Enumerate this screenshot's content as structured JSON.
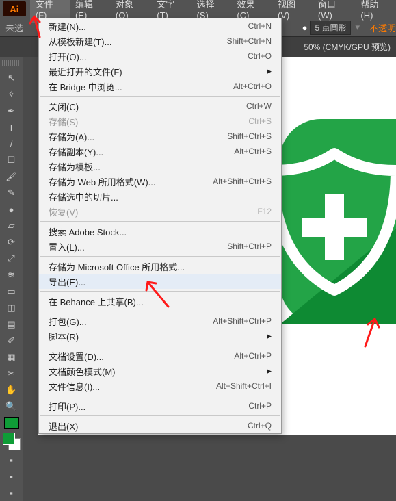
{
  "app": {
    "icon_text": "Ai"
  },
  "menubar": {
    "items": [
      {
        "label": "文件(F)",
        "active": true
      },
      {
        "label": "编辑(E)"
      },
      {
        "label": "对象(O)"
      },
      {
        "label": "文字(T)"
      },
      {
        "label": "选择(S)"
      },
      {
        "label": "效果(C)"
      },
      {
        "label": "视图(V)"
      },
      {
        "label": "窗口(W)"
      },
      {
        "label": "帮助(H)"
      }
    ]
  },
  "optionsbar": {
    "left_label": "未选",
    "round_label": "5 点圆形",
    "opacity_label": "不透明"
  },
  "tabbar": {
    "doc_status": "50% (CMYK/GPU 预览)"
  },
  "tools": {
    "names": [
      "selection",
      "magic-wand",
      "pen",
      "type",
      "line",
      "rectangle",
      "paintbrush",
      "pencil",
      "blob-brush",
      "eraser",
      "rotate",
      "scale",
      "width",
      "free-transform",
      "shape-builder",
      "gradient",
      "eyedropper",
      "artboard",
      "crop",
      "hand",
      "zoom",
      "fill-green",
      "swatch-pair",
      "misc-a",
      "misc-b",
      "misc-c"
    ]
  },
  "dropdown": {
    "items": [
      {
        "label": "新建(N)...",
        "shortcut": "Ctrl+N",
        "enabled": true
      },
      {
        "label": "从模板新建(T)...",
        "shortcut": "Shift+Ctrl+N",
        "enabled": true
      },
      {
        "label": "打开(O)...",
        "shortcut": "Ctrl+O",
        "enabled": true
      },
      {
        "label": "最近打开的文件(F)",
        "shortcut": "",
        "enabled": true,
        "submenu": true
      },
      {
        "label": "在 Bridge 中浏览...",
        "shortcut": "Alt+Ctrl+O",
        "enabled": true
      },
      {
        "sep": true
      },
      {
        "label": "关闭(C)",
        "shortcut": "Ctrl+W",
        "enabled": true
      },
      {
        "label": "存储(S)",
        "shortcut": "Ctrl+S",
        "enabled": false
      },
      {
        "label": "存储为(A)...",
        "shortcut": "Shift+Ctrl+S",
        "enabled": true
      },
      {
        "label": "存储副本(Y)...",
        "shortcut": "Alt+Ctrl+S",
        "enabled": true
      },
      {
        "label": "存储为模板...",
        "shortcut": "",
        "enabled": true
      },
      {
        "label": "存储为 Web 所用格式(W)...",
        "shortcut": "Alt+Shift+Ctrl+S",
        "enabled": true
      },
      {
        "label": "存储选中的切片...",
        "shortcut": "",
        "enabled": true
      },
      {
        "label": "恢复(V)",
        "shortcut": "F12",
        "enabled": false
      },
      {
        "sep": true
      },
      {
        "label": "搜索 Adobe Stock...",
        "shortcut": "",
        "enabled": true
      },
      {
        "label": "置入(L)...",
        "shortcut": "Shift+Ctrl+P",
        "enabled": true
      },
      {
        "sep": true
      },
      {
        "label": "存储为 Microsoft Office 所用格式...",
        "shortcut": "",
        "enabled": true
      },
      {
        "label": "导出(E)...",
        "shortcut": "",
        "enabled": true,
        "highlight": true
      },
      {
        "sep": true
      },
      {
        "label": "在 Behance 上共享(B)...",
        "shortcut": "",
        "enabled": true
      },
      {
        "sep": true
      },
      {
        "label": "打包(G)...",
        "shortcut": "Alt+Shift+Ctrl+P",
        "enabled": true
      },
      {
        "label": "脚本(R)",
        "shortcut": "",
        "enabled": true,
        "submenu": true
      },
      {
        "sep": true
      },
      {
        "label": "文档设置(D)...",
        "shortcut": "Alt+Ctrl+P",
        "enabled": true
      },
      {
        "label": "文档颜色模式(M)",
        "shortcut": "",
        "enabled": true,
        "submenu": true
      },
      {
        "label": "文件信息(I)...",
        "shortcut": "Alt+Shift+Ctrl+I",
        "enabled": true
      },
      {
        "sep": true
      },
      {
        "label": "打印(P)...",
        "shortcut": "Ctrl+P",
        "enabled": true
      },
      {
        "sep": true
      },
      {
        "label": "退出(X)",
        "shortcut": "Ctrl+Q",
        "enabled": true
      }
    ]
  },
  "annotations": {
    "arrow1": {
      "points_to": "menubar-file"
    },
    "arrow2": {
      "points_to": "export-menu-item"
    },
    "arrow3": {
      "points_to": "artboard-corner"
    }
  }
}
